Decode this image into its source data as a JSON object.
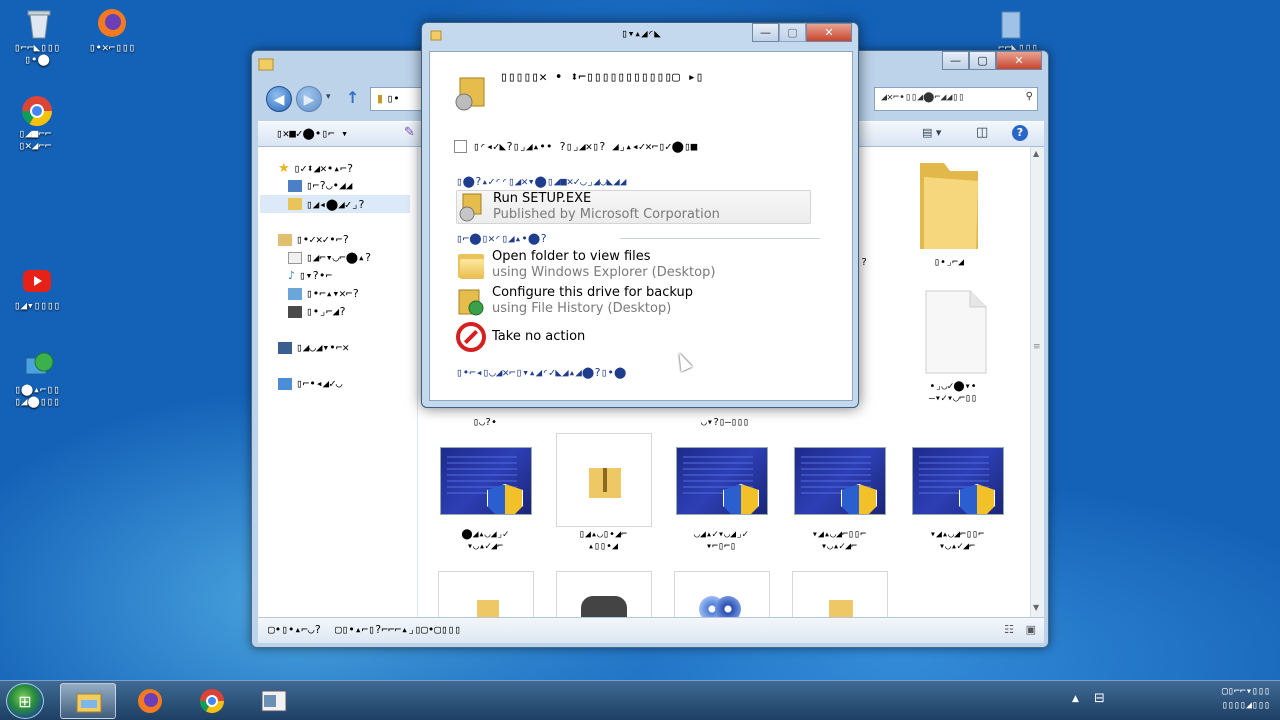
{
  "desktop": {
    "icons": [
      {
        "name": "recycle-bin",
        "label_l1": "▯⌐⌐◣▯▯▯",
        "label_l2": "▯•⬤"
      },
      {
        "name": "firefox",
        "label_l1": "▯•✕⌐▯▯▯"
      },
      {
        "name": "chrome",
        "label_l1": "▯◢■⌐⌐",
        "label_l2": "▯✕◢⌐⌐"
      },
      {
        "name": "youtube",
        "label_l1": "▯◢▾▯▯▯▯"
      },
      {
        "name": "network",
        "label_l1": "▯⬤▴⌐▯▯",
        "label_l2": "▯◢⬤▯▯▯"
      },
      {
        "name": "top-right",
        "label_l1": "⌐⌐◣▯▯▯"
      }
    ]
  },
  "explorer": {
    "search_text": "◢✕⌐•▯▯◢⬤⌐◢◢▯▯",
    "address_text": "▯•",
    "toolbar_organize": "▯✕■✓⬤•▯⌐ ▾",
    "nav": {
      "favorites": "▯✓⬍◢✕•▴⌐?",
      "fav_desktop": "▯⌐?◡•◢◢",
      "fav_downloads": "▯◢◂⬤◢✓⌟?",
      "libraries": "▯•✓✕✓•⌐?",
      "lib_docs": "▯◢⌐▾◡⌐⬤▴?",
      "lib_music": "▯▾?•⌐",
      "lib_pictures": "▯•⌐▴▾✕⌐?",
      "lib_videos": "▯•⌟⌐◢?",
      "computer": "▯◢◡◢▾•⌐✕",
      "network": "▯⌐•◂◢✓◡"
    },
    "content": {
      "top_folder_label": "▯•⌟⌐◢",
      "blank_file_label_l1": "•⌟◡✓⬤▾•",
      "blank_file_label_l2": "–▾✓▾◡⌐▯▯",
      "row2_labels": [
        {
          "l1": "⬤◢▴◡◢⌟✓",
          "l2": "▾◡▴✓◢⌐"
        },
        {
          "l1": "▯◢▴◡▯•◢⌐",
          "l2": "▴▯▯•◢"
        },
        {
          "l1": "◡◢▴✓▾◡◢⌟✓",
          "l2": "▾⌐▯⌐▯"
        },
        {
          "l1": "▾◢▴◡◢⌐▯▯⌐",
          "l2": "▾◡▴✓◢⌐"
        },
        {
          "l1": "▾◢▴◡◢⌐▯▯⌐",
          "l2": "▾◡▴✓◢⌐"
        }
      ],
      "partial_labels": [
        "▯◡?•",
        "◡▾?▯–▯▯▯"
      ]
    },
    "status": {
      "items": "▢•▯•▴⌐◡?",
      "selected": "▢▯•▴⌐▯?⌐⌐⌐▴⌟▯▢•▢▯▯▯"
    }
  },
  "autoplay": {
    "title": "▯▾▴◢◜◣",
    "heading": "▯▯▯▯▯✕ • ⬍⌐▯▯▯▯▯▯▯▯▯▯▯▢ ▸▯",
    "checkbox_label": "▯◜◂✓◣?▯⌟◢▴•• ?▯⌟◢✕▯? ◢⌟▴◂✓✕⌐▯✓⬤▯■",
    "section_install": "▯⬤?▴✓◜◜▯◢✕▾⬤▯◢■✕✓◡⌟◢◡◣◢◢",
    "section_general": "▯⌐⬤▯✕◜▯◢▴•⬤?",
    "footer": "▯•⌐◂▯◡◢✕⌐▯▾▴◢◜✓◣◢▴◢⬤?▯•⬤",
    "options": [
      {
        "title": "Run SETUP.EXE",
        "sub": "Published by Microsoft Corporation"
      },
      {
        "title": "Open folder to view files",
        "sub": "using Windows Explorer (Desktop)"
      },
      {
        "title": "Configure this drive for backup",
        "sub": "using File History (Desktop)"
      },
      {
        "title": "Take no action",
        "sub": ""
      }
    ]
  },
  "taskbar": {
    "clock_time": "▢▯⌐⌐▾▯▯▯",
    "clock_date": "▯▯▯▯◢▯▯▯"
  },
  "colors": {
    "dialog_section": "#1f3d8c",
    "subtext": "#7a7a7a",
    "desktop": "#1a6fc4"
  }
}
